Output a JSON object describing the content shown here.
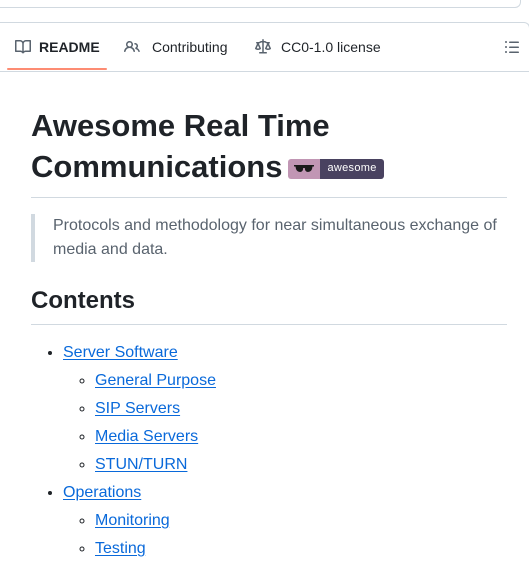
{
  "tabs": [
    {
      "label": "README",
      "icon": "book-icon",
      "active": true
    },
    {
      "label": "Contributing",
      "icon": "people-icon",
      "active": false
    },
    {
      "label": "CC0-1.0 license",
      "icon": "law-icon",
      "active": false
    }
  ],
  "readme": {
    "title": "Awesome Real Time Communications",
    "badge_text": "awesome",
    "description": "Protocols and methodology for near simultaneous exchange of media and data.",
    "contents_heading": "Contents",
    "toc": [
      {
        "label": "Server Software",
        "children": [
          "General Purpose",
          "SIP Servers",
          "Media Servers",
          "STUN/TURN"
        ]
      },
      {
        "label": "Operations",
        "children": [
          "Monitoring",
          "Testing"
        ]
      }
    ]
  },
  "colors": {
    "accent_underline": "#fd8c73",
    "link": "#0969da",
    "badge_left": "#c196b4",
    "badge_right": "#494260"
  }
}
